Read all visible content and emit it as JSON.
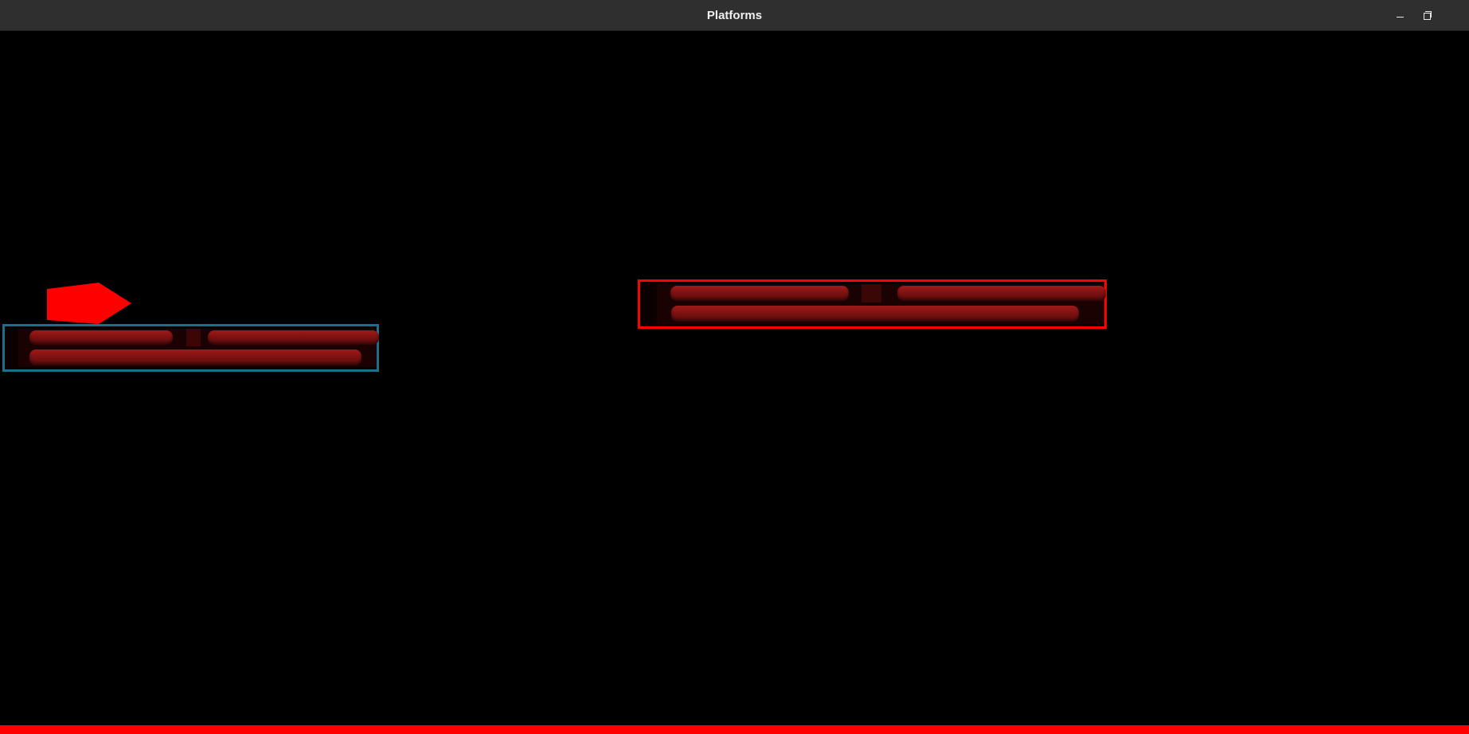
{
  "window": {
    "title": "Platforms",
    "controls": {
      "minimize": "minimize-icon",
      "maximize": "maximize-icon",
      "close": "close-icon"
    }
  },
  "game": {
    "background_color": "#000000",
    "player": {
      "shape": "pentagon-arrow",
      "color": "#ff0000",
      "facing": "right"
    },
    "platforms": [
      {
        "id": "left",
        "border_color": "#1a6f8a",
        "state": "standing-on"
      },
      {
        "id": "right",
        "border_color": "#ff0000",
        "state": "idle"
      }
    ],
    "ground": {
      "color": "#ff0000"
    }
  }
}
